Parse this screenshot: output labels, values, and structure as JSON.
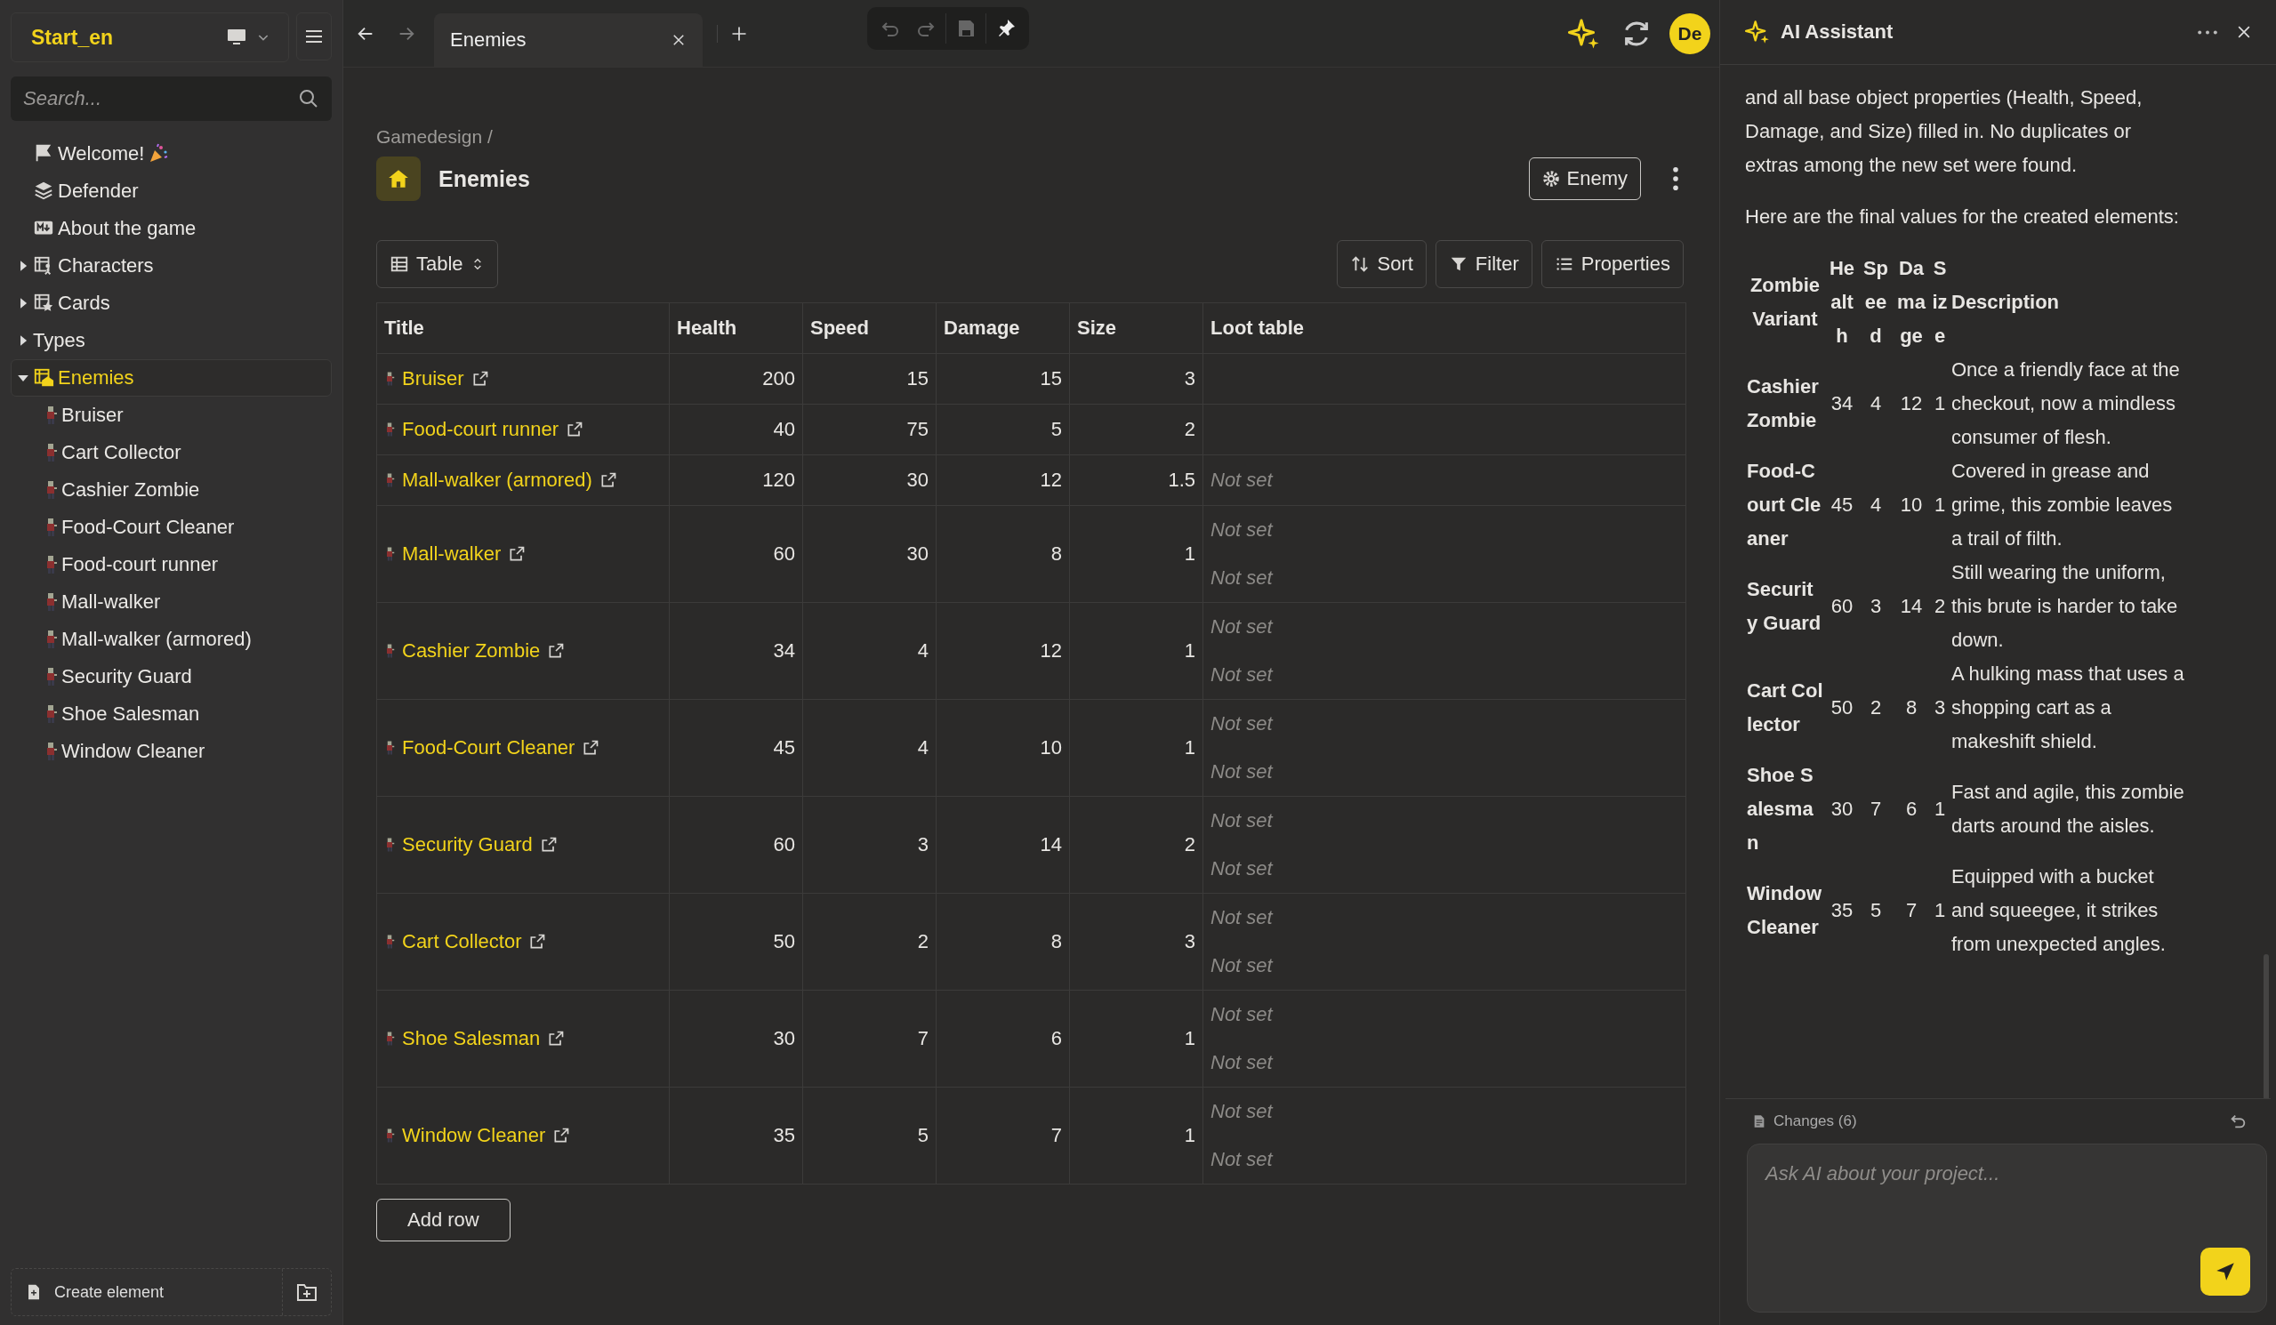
{
  "sidebar": {
    "project": "Start_en",
    "search": {
      "placeholder": "Search..."
    },
    "items": [
      {
        "label": "Welcome!",
        "kind": "page",
        "expanded": false,
        "selected": false
      },
      {
        "label": "Defender",
        "kind": "page",
        "expanded": false,
        "selected": false
      },
      {
        "label": "About the game",
        "kind": "page",
        "expanded": false,
        "selected": false
      },
      {
        "label": "Characters",
        "kind": "folder",
        "expanded": false,
        "selected": false
      },
      {
        "label": "Cards",
        "kind": "folder",
        "expanded": false,
        "selected": false
      },
      {
        "label": "Types",
        "kind": "folder",
        "expanded": false,
        "selected": false
      },
      {
        "label": "Enemies",
        "kind": "folder",
        "expanded": true,
        "selected": true,
        "children": [
          {
            "label": "Bruiser",
            "selected": false
          },
          {
            "label": "Cart Collector",
            "selected": false
          },
          {
            "label": "Cashier Zombie",
            "selected": false
          },
          {
            "label": "Food-Court Cleaner",
            "selected": false
          },
          {
            "label": "Food-court runner",
            "selected": false
          },
          {
            "label": "Mall-walker",
            "selected": false
          },
          {
            "label": "Mall-walker (armored)",
            "selected": false
          },
          {
            "label": "Security Guard",
            "selected": false
          },
          {
            "label": "Shoe Salesman",
            "selected": false
          },
          {
            "label": "Window Cleaner",
            "selected": false
          }
        ]
      }
    ],
    "create_button": "Create element"
  },
  "tabs": [
    {
      "label": "Enemies",
      "selected": true
    }
  ],
  "avatar": "De",
  "page": {
    "breadcrumb": "Gamedesign /",
    "title": "Enemies",
    "type_button": "Enemy",
    "view": "Table",
    "actions": [
      "Sort",
      "Filter",
      "Properties"
    ],
    "table": {
      "columns": [
        "Title",
        "Health",
        "Speed",
        "Damage",
        "Size",
        "Loot table"
      ],
      "rows": [
        {
          "title": "Bruiser",
          "health": "200",
          "speed": "15",
          "damage": "15",
          "size": "3"
        },
        {
          "title": "Food-court runner",
          "health": "40",
          "speed": "75",
          "damage": "5",
          "size": "2"
        },
        {
          "title": "Mall-walker (armored)",
          "health": "120",
          "speed": "30",
          "damage": "12",
          "size": "1.5",
          "loot": [
            "Not set"
          ]
        },
        {
          "title": "Mall-walker",
          "health": "60",
          "speed": "30",
          "damage": "8",
          "size": "1",
          "loot": [
            "Not set",
            "Not set"
          ]
        },
        {
          "title": "Cashier Zombie",
          "health": "34",
          "speed": "4",
          "damage": "12",
          "size": "1",
          "loot": [
            "Not set",
            "Not set"
          ]
        },
        {
          "title": "Food-Court Cleaner",
          "health": "45",
          "speed": "4",
          "damage": "10",
          "size": "1",
          "loot": [
            "Not set",
            "Not set"
          ]
        },
        {
          "title": "Security Guard",
          "health": "60",
          "speed": "3",
          "damage": "14",
          "size": "2",
          "loot": [
            "Not set",
            "Not set"
          ]
        },
        {
          "title": "Cart Collector",
          "health": "50",
          "speed": "2",
          "damage": "8",
          "size": "3",
          "loot": [
            "Not set",
            "Not set"
          ]
        },
        {
          "title": "Shoe Salesman",
          "health": "30",
          "speed": "7",
          "damage": "6",
          "size": "1",
          "loot": [
            "Not set",
            "Not set"
          ]
        },
        {
          "title": "Window Cleaner",
          "health": "35",
          "speed": "5",
          "damage": "7",
          "size": "1",
          "loot": [
            "Not set",
            "Not set"
          ]
        }
      ]
    },
    "add_row": "Add row"
  },
  "ai_assistant": {
    "title": "AI Assistant",
    "paragraphs": [
      "and all base object properties (Health, Speed, Damage, and Size) filled in. No duplicates or extras among the new set were found.",
      "Here are the final values for the created elements:"
    ],
    "table": {
      "columns": [
        "Zombie Variant",
        "Health",
        "Speed",
        "Damage",
        "Size",
        "Description"
      ],
      "rows": [
        [
          "Cashier Zombie",
          "34",
          "4",
          "12",
          "1",
          "Once a friendly face at the checkout, now a mindless consumer of flesh."
        ],
        [
          "Food-Court Cleaner",
          "45",
          "4",
          "10",
          "1",
          "Covered in grease and grime, this zombie leaves a trail of filth."
        ],
        [
          "Security Guard",
          "60",
          "3",
          "14",
          "2",
          "Still wearing the uniform, this brute is harder to take down."
        ],
        [
          "Cart Collector",
          "50",
          "2",
          "8",
          "3",
          "A hulking mass that uses a shopping cart as a makeshift shield."
        ],
        [
          "Shoe Salesman",
          "30",
          "7",
          "6",
          "1",
          "Fast and agile, this zombie darts around the aisles."
        ],
        [
          "Window Cleaner",
          "35",
          "5",
          "7",
          "1",
          "Equipped with a bucket and squeegee, it strikes from unexpected angles."
        ]
      ]
    },
    "changes": "Changes (6)",
    "input": {
      "placeholder": "Ask AI about your project..."
    }
  }
}
